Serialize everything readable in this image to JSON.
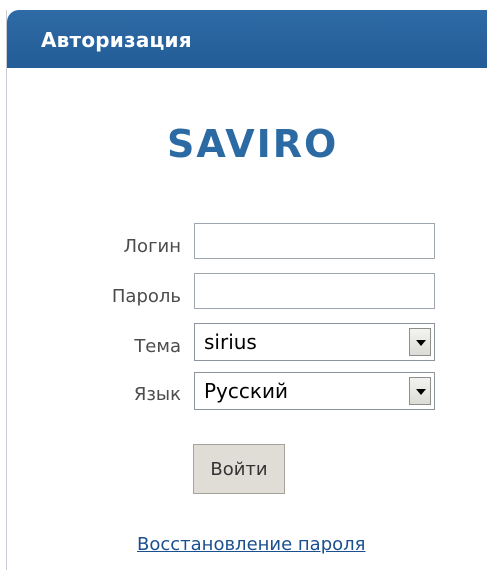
{
  "panel": {
    "title": "Авторизация"
  },
  "logo": {
    "text": "SAVIRO"
  },
  "form": {
    "login_label": "Логин",
    "login_value": "",
    "password_label": "Пароль",
    "password_value": "",
    "theme_label": "Тема",
    "theme_value": "sirius",
    "language_label": "Язык",
    "language_value": "Русский",
    "submit_label": "Войти"
  },
  "links": {
    "recover_password": "Восстановление пароля"
  },
  "colors": {
    "header": "#235d97",
    "logo": "#2c6aa3",
    "link": "#1c4f8e",
    "button": "#e0ddd6"
  },
  "icons": {
    "select_arrow": "chevron-down-icon"
  }
}
